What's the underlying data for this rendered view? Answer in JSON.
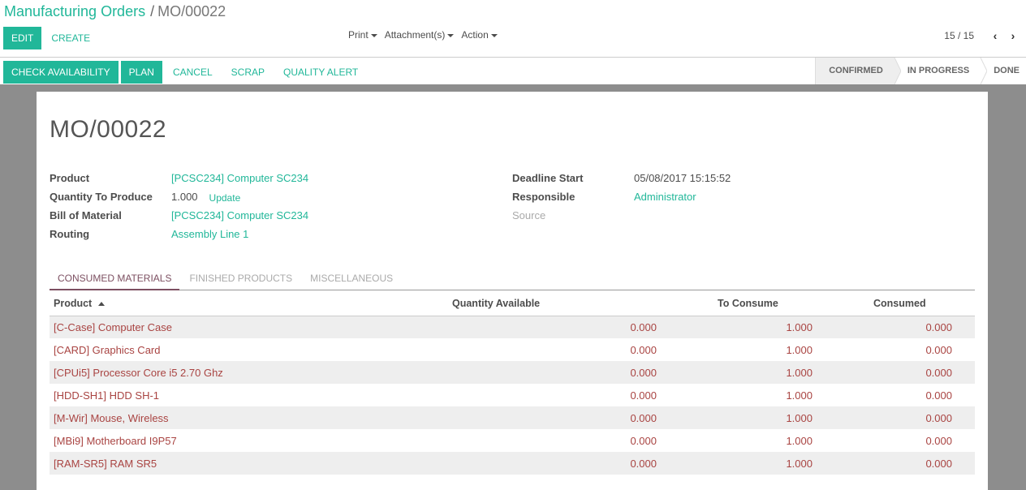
{
  "breadcrumb": {
    "parent": "Manufacturing Orders",
    "separator": "/",
    "current": "MO/00022"
  },
  "toolbar": {
    "edit_label": "EDIT",
    "create_label": "CREATE"
  },
  "sidebar": {
    "print_label": "Print",
    "attachments_label": "Attachment(s)",
    "action_label": "Action"
  },
  "pager": {
    "value": "15 / 15"
  },
  "statusbar": {
    "buttons": [
      "CHECK AVAILABILITY",
      "PLAN",
      "CANCEL",
      "SCRAP",
      "QUALITY ALERT"
    ],
    "stages": [
      {
        "label": "CONFIRMED",
        "active": true
      },
      {
        "label": "IN PROGRESS",
        "active": false
      },
      {
        "label": "DONE",
        "active": false
      }
    ]
  },
  "record": {
    "title": "MO/00022",
    "left_fields": [
      {
        "label": "Product",
        "value": "[PCSC234] Computer SC234"
      },
      {
        "label": "Quantity To Produce",
        "value": "1.000",
        "action": "Update"
      },
      {
        "label": "Bill of Material",
        "value": "[PCSC234] Computer SC234"
      },
      {
        "label": "Routing",
        "value": "Assembly Line 1"
      }
    ],
    "right_fields": [
      {
        "label": "Deadline Start",
        "value": "05/08/2017 15:15:52"
      },
      {
        "label": "Responsible",
        "value": "Administrator"
      },
      {
        "label": "Source",
        "value": ""
      }
    ]
  },
  "tabs": [
    "CONSUMED MATERIALS",
    "FINISHED PRODUCTS",
    "MISCELLANEOUS"
  ],
  "table": {
    "columns": [
      "Product",
      "Quantity Available",
      "To Consume",
      "Consumed"
    ],
    "rows": [
      [
        "[C-Case] Computer Case",
        "0.000",
        "1.000",
        "0.000"
      ],
      [
        "[CARD] Graphics Card",
        "0.000",
        "1.000",
        "0.000"
      ],
      [
        "[CPUi5] Processor Core i5 2.70 Ghz",
        "0.000",
        "1.000",
        "0.000"
      ],
      [
        "[HDD-SH1] HDD SH-1",
        "0.000",
        "1.000",
        "0.000"
      ],
      [
        "[M-Wir] Mouse, Wireless",
        "0.000",
        "1.000",
        "0.000"
      ],
      [
        "[MBi9] Motherboard I9P57",
        "0.000",
        "1.000",
        "0.000"
      ],
      [
        "[RAM-SR5] RAM SR5",
        "0.000",
        "1.000",
        "0.000"
      ]
    ]
  },
  "colors": {
    "primary": "#21b799",
    "warning_text": "#a94442",
    "tab_active": "#7c4f61"
  }
}
